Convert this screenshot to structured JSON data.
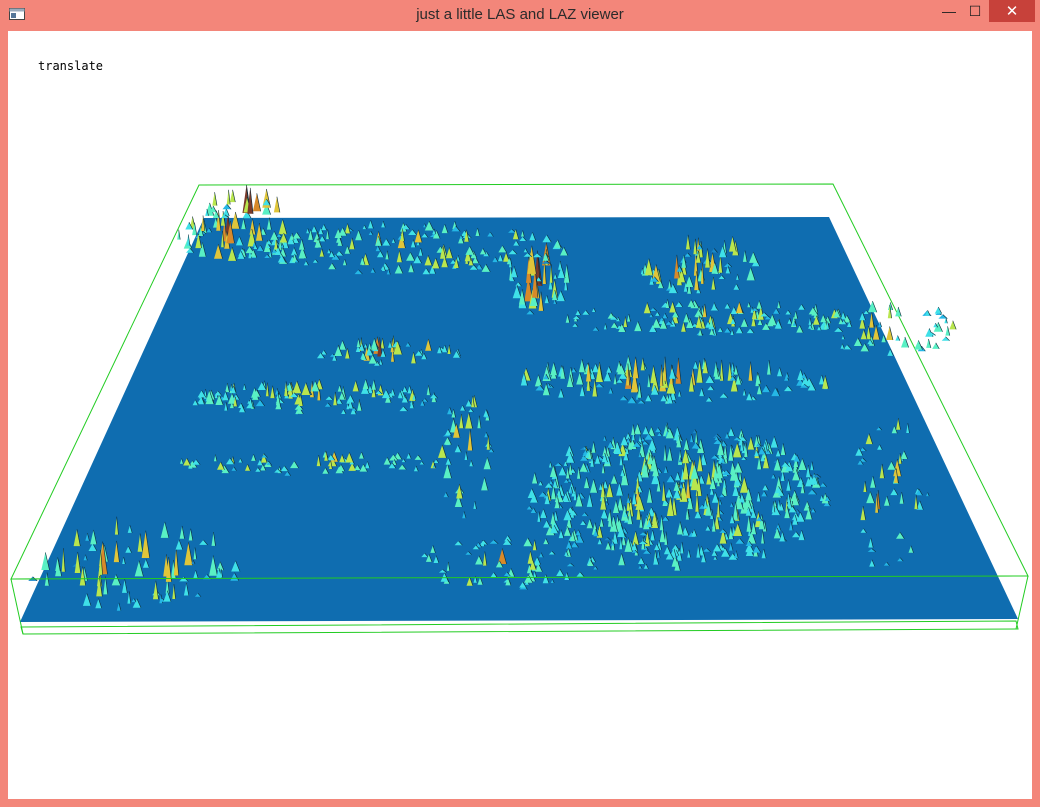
{
  "window": {
    "title": "just a little LAS and LAZ viewer",
    "frame_color": "#f3867a",
    "close_color": "#c7413a"
  },
  "controls": {
    "minimize_glyph": "—",
    "maximize_glyph": "☐",
    "close_glyph": "✕"
  },
  "viewer": {
    "mode_label": "translate",
    "background": "#ffffff",
    "surface_color": "#0f6db0",
    "bounding_box_color": "#22cc22",
    "palette": [
      "#1a88c9",
      "#25b7e6",
      "#3fe0e8",
      "#59f0c4",
      "#b9e64e",
      "#e0c53a",
      "#d88a2a",
      "#7a3a2a"
    ]
  }
}
